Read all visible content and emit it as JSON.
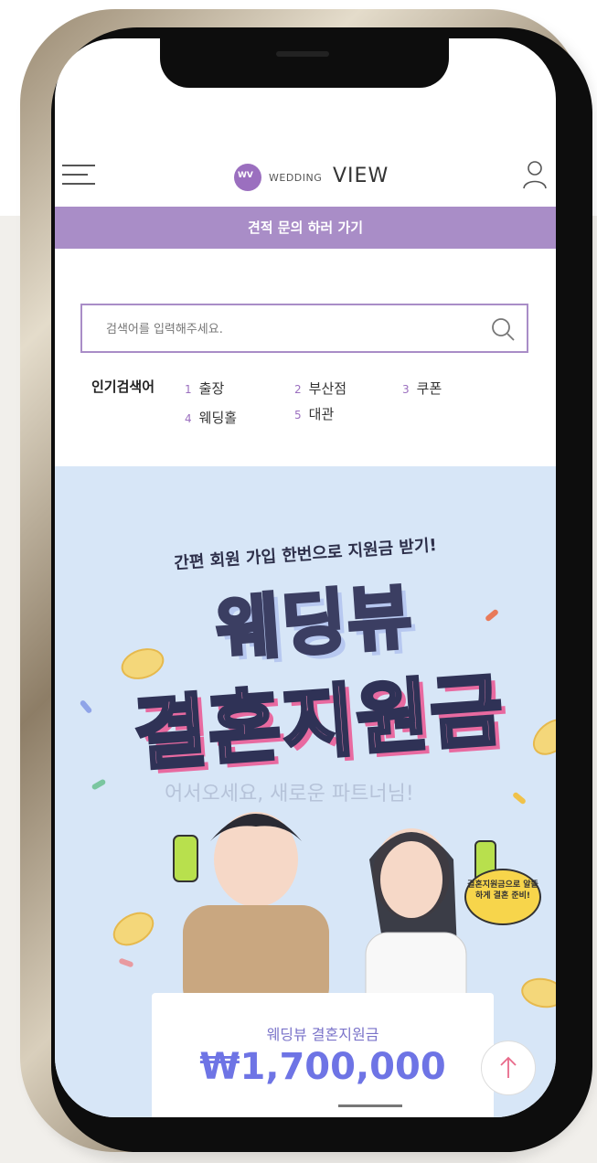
{
  "header": {
    "logo_mark": "WV",
    "logo_small": "WEDDING",
    "logo_big": "VIEW",
    "menu_icon": "hamburger-menu-icon",
    "user_icon": "user-icon"
  },
  "quote_bar": {
    "label": "견적 문의 하러 가기"
  },
  "search": {
    "placeholder": "검색어를 입력해주세요.",
    "icon": "search-icon"
  },
  "popular": {
    "label": "인기검색어",
    "items": [
      {
        "rank": "1",
        "text": "출장"
      },
      {
        "rank": "2",
        "text": "부산점"
      },
      {
        "rank": "3",
        "text": "쿠폰"
      },
      {
        "rank": "4",
        "text": "웨딩홀"
      },
      {
        "rank": "5",
        "text": "대관"
      }
    ]
  },
  "banner": {
    "subtitle": "간편 회원 가입 한번으로 지원금 받기!",
    "title_line1": "웨딩뷰",
    "title_line2": "결혼지원금",
    "faded_text": "어서오세요, 새로운 파트너님!",
    "speech_bubble": "결혼지원금으로 알뜰하게 결혼 준비!",
    "colors": {
      "background": "#d7e6f7",
      "title_pink": "#f58cb7",
      "accent_purple": "#a98dc7"
    }
  },
  "price_card": {
    "label": "웨딩뷰 결혼지원금",
    "value": "₩1,700,000"
  },
  "scroll_top": {
    "icon": "arrow-up-icon"
  }
}
